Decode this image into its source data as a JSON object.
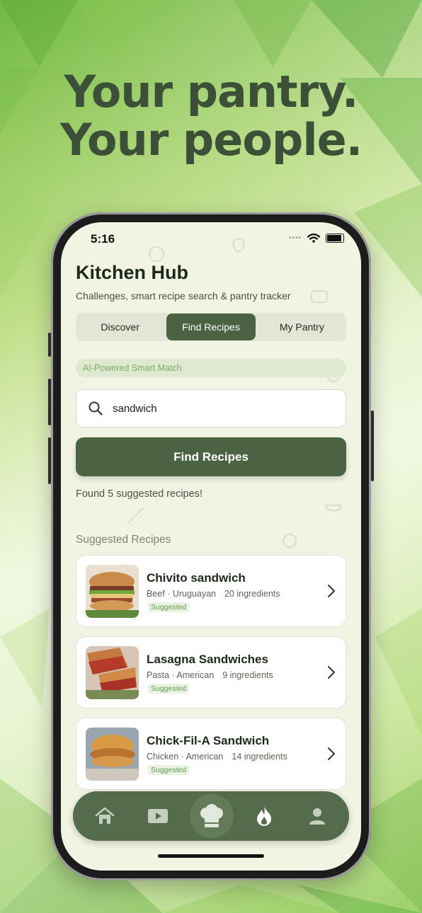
{
  "marketing": {
    "headline_line1": "Your pantry.",
    "headline_line2": "Your people."
  },
  "status_bar": {
    "time": "5:16"
  },
  "app": {
    "title": "Kitchen Hub",
    "subtitle": "Challenges, smart recipe search & pantry tracker"
  },
  "segments": [
    {
      "label": "Discover",
      "active": false
    },
    {
      "label": "Find Recipes",
      "active": true
    },
    {
      "label": "My Pantry",
      "active": false
    }
  ],
  "ai_badge": "AI-Powered Smart Match",
  "search": {
    "value": "sandwich",
    "icon": "search-icon"
  },
  "find_button": "Find Recipes",
  "result_message": "Found 5 suggested recipes!",
  "section_title": "Suggested Recipes",
  "recipes": [
    {
      "name": "Chivito sandwich",
      "meta": "Beef · Uruguayan",
      "ingredients": "20 ingredients",
      "badge": "Suggested"
    },
    {
      "name": "Lasagna Sandwiches",
      "meta": "Pasta · American",
      "ingredients": "9 ingredients",
      "badge": "Suggested"
    },
    {
      "name": "Chick-Fil-A Sandwich",
      "meta": "Chicken · American",
      "ingredients": "14 ingredients",
      "badge": "Suggested"
    }
  ],
  "tab_bar": {
    "tabs": [
      "home-icon",
      "video-icon",
      "chef-hat-icon",
      "flame-icon",
      "profile-icon"
    ],
    "active": "chef-hat-icon"
  },
  "colors": {
    "accent": "#4b6343",
    "headline": "#3c5038",
    "screen_bg": "#f1f3e3",
    "badge_text": "#5d9a4e"
  }
}
